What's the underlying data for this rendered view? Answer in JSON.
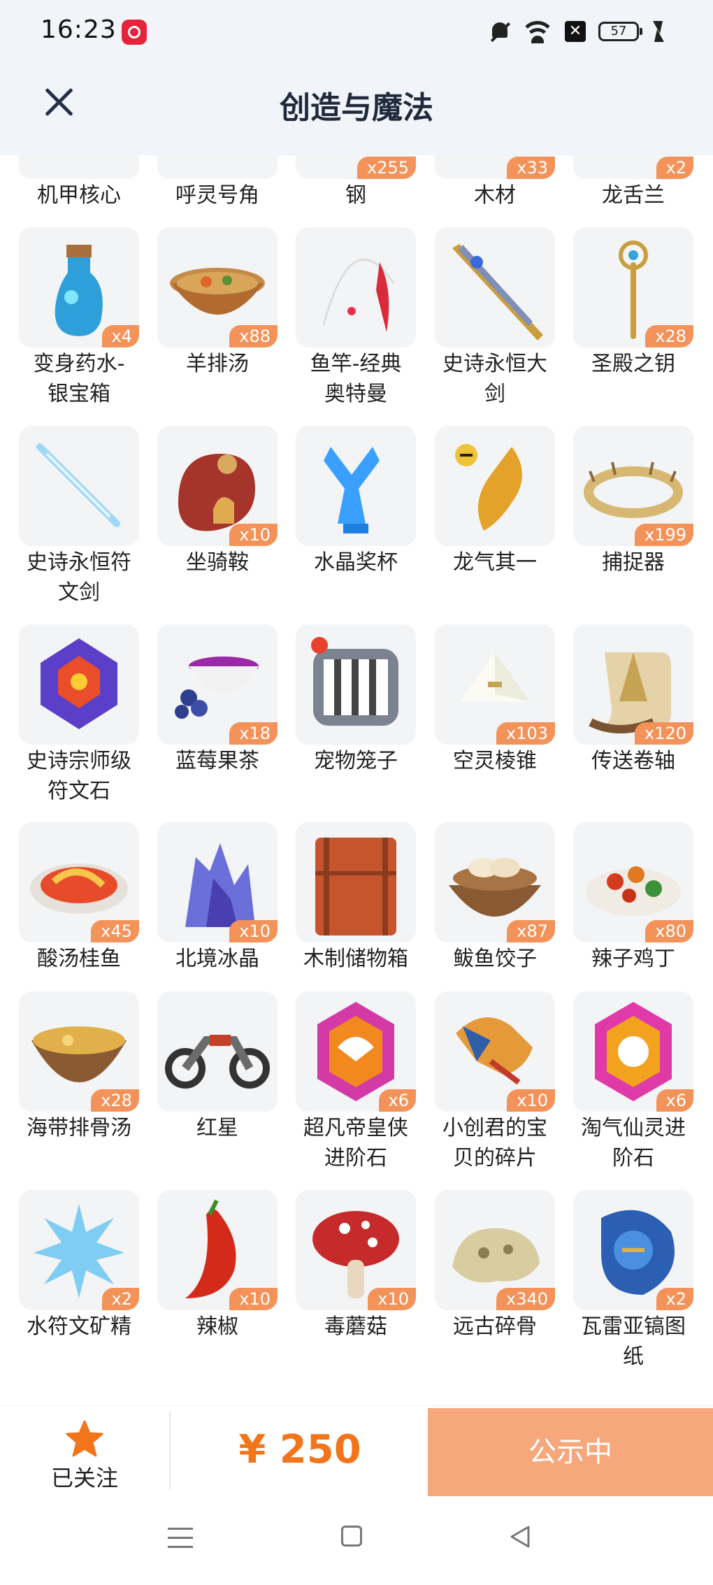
{
  "status_bar": {
    "time": "16:23",
    "battery": "57"
  },
  "header": {
    "title": "创造与魔法"
  },
  "items": [
    {
      "name": "机甲核心",
      "qty": ""
    },
    {
      "name": "呼灵号角",
      "qty": ""
    },
    {
      "name": "钢",
      "qty": "x255"
    },
    {
      "name": "木材",
      "qty": "x33"
    },
    {
      "name": "龙舌兰",
      "qty": "x2"
    },
    {
      "name": "变身药水-银宝箱",
      "line1": "变身药水-",
      "line2": "银宝箱",
      "qty": "x4"
    },
    {
      "name": "羊排汤",
      "qty": "x88"
    },
    {
      "name": "鱼竿-经典奥特曼",
      "line1": "鱼竿-经典",
      "line2": "奥特曼",
      "qty": ""
    },
    {
      "name": "史诗永恒大剑",
      "line1": "史诗永恒大",
      "line2": "剑",
      "qty": ""
    },
    {
      "name": "圣殿之钥",
      "qty": "x28"
    },
    {
      "name": "史诗永恒符文剑",
      "line1": "史诗永恒符",
      "line2": "文剑",
      "qty": ""
    },
    {
      "name": "坐骑鞍",
      "qty": "x10"
    },
    {
      "name": "水晶奖杯",
      "qty": ""
    },
    {
      "name": "龙气其一",
      "qty": ""
    },
    {
      "name": "捕捉器",
      "qty": "x199"
    },
    {
      "name": "史诗宗师级符文石",
      "line1": "史诗宗师级",
      "line2": "符文石",
      "qty": ""
    },
    {
      "name": "蓝莓果茶",
      "qty": "x18"
    },
    {
      "name": "宠物笼子",
      "qty": ""
    },
    {
      "name": "空灵棱锥",
      "qty": "x103"
    },
    {
      "name": "传送卷轴",
      "qty": "x120"
    },
    {
      "name": "酸汤桂鱼",
      "qty": "x45"
    },
    {
      "name": "北境冰晶",
      "qty": "x10"
    },
    {
      "name": "木制储物箱",
      "qty": ""
    },
    {
      "name": "鲅鱼饺子",
      "qty": "x87"
    },
    {
      "name": "辣子鸡丁",
      "qty": "x80"
    },
    {
      "name": "海带排骨汤",
      "qty": "x28"
    },
    {
      "name": "红星",
      "qty": ""
    },
    {
      "name": "超凡帝皇侠进阶石",
      "line1": "超凡帝皇侠",
      "line2": "进阶石",
      "qty": "x6"
    },
    {
      "name": "小创君的宝贝的碎片",
      "line1": "小创君的宝",
      "line2": "贝的碎片",
      "qty": "x10"
    },
    {
      "name": "淘气仙灵进阶石",
      "line1": "淘气仙灵进",
      "line2": "阶石",
      "qty": "x6"
    },
    {
      "name": "水符文矿精",
      "qty": "x2"
    },
    {
      "name": "辣椒",
      "qty": "x10"
    },
    {
      "name": "毒蘑菇",
      "qty": "x10"
    },
    {
      "name": "远古碎骨",
      "qty": "x340"
    },
    {
      "name": "瓦雷亚镐图纸",
      "line1": "瓦雷亚镐图",
      "line2": "纸",
      "qty": "x2"
    }
  ],
  "footer": {
    "follow_label": "已关注",
    "price": "¥ 250",
    "status_button": "公示中"
  },
  "colors": {
    "accent": "#f2751c",
    "badge": "#f3935a",
    "status_button": "#f7a77c",
    "header_bg": "#f1f4f8"
  }
}
